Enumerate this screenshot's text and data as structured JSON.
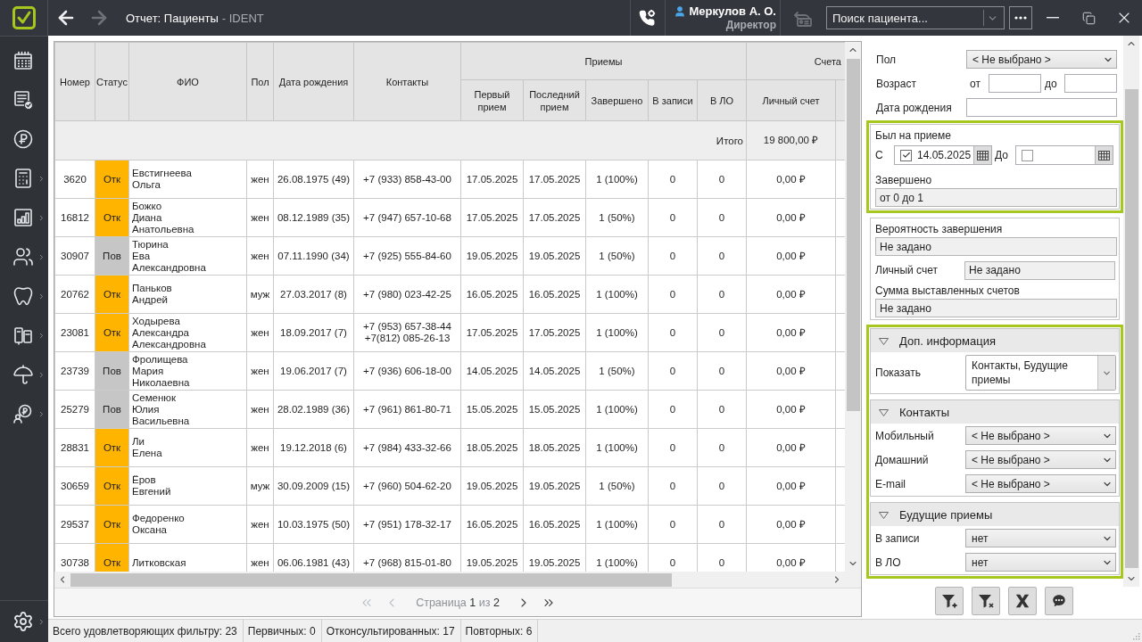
{
  "header": {
    "nav": [
      {
        "kind": "back",
        "disabled": false
      },
      {
        "kind": "forward",
        "disabled": true
      }
    ],
    "title": "Отчет: Пациенты",
    "suffix": "- IDENT",
    "user": {
      "name": "Меркулов А. О.",
      "role": "Директор"
    },
    "return_button": {
      "disabled": true
    },
    "search": {
      "placeholder": "Поиск пациента..."
    }
  },
  "sidebar": {
    "items": [
      {
        "kind": "schedule",
        "submenu": false
      },
      {
        "kind": "tasks",
        "submenu": false
      },
      {
        "kind": "payments",
        "submenu": false
      },
      {
        "kind": "cashbox",
        "submenu": true
      },
      {
        "kind": "reports",
        "submenu": true
      },
      {
        "kind": "patients",
        "submenu": true
      },
      {
        "kind": "dentistry",
        "submenu": true
      },
      {
        "kind": "equipment",
        "submenu": true
      },
      {
        "kind": "insurance",
        "submenu": true
      },
      {
        "kind": "loyalty",
        "submenu": true
      }
    ],
    "footer": {
      "kind": "settings",
      "submenu": true
    }
  },
  "table": {
    "columns": [
      {
        "label": "Номер"
      },
      {
        "label": "Статус"
      },
      {
        "label": "ФИО"
      },
      {
        "label": "Пол"
      },
      {
        "label": "Дата рождения"
      },
      {
        "label": "Контакты"
      },
      {
        "label": "Приемы",
        "children": [
          {
            "label": "Первый прием"
          },
          {
            "label": "Последний прием"
          },
          {
            "label": "Завершено"
          },
          {
            "label": "В записи"
          },
          {
            "label": "В ЛО"
          }
        ]
      },
      {
        "label": "Счета",
        "children": [
          {
            "label": "Личный счет"
          }
        ]
      }
    ],
    "totals": {
      "label": "Итого",
      "personal_account": "19 800,00 ₽"
    },
    "rows": [
      {
        "number": "3620",
        "status": {
          "label": "Отк",
          "color": "#ffb400"
        },
        "name": "Евстигнеева\nОльга",
        "sex": "жен",
        "birth_date": "26.08.1975 (49)",
        "contacts": "+7 (933) 858-43-00",
        "first_visit": "17.05.2025",
        "last_visit": "17.05.2025",
        "completed": "1 (100%)",
        "scheduled": "0",
        "in_lo": "0",
        "personal_account": "0,00 ₽"
      },
      {
        "number": "16812",
        "status": {
          "label": "Отк",
          "color": "#ffb400"
        },
        "name": "Божко\nДиана\nАнатольевна",
        "sex": "жен",
        "birth_date": "08.12.1989 (35)",
        "contacts": "+7 (947) 657-10-68",
        "first_visit": "17.05.2025",
        "last_visit": "17.05.2025",
        "completed": "1 (50%)",
        "scheduled": "0",
        "in_lo": "0",
        "personal_account": "0,00 ₽"
      },
      {
        "number": "30907",
        "status": {
          "label": "Пов",
          "color": "#c6c6c6"
        },
        "name": "Тюрина\nЕва\nАлександровна",
        "sex": "жен",
        "birth_date": "07.11.1990 (34)",
        "contacts": "+7 (925) 555-84-60",
        "first_visit": "19.05.2025",
        "last_visit": "19.05.2025",
        "completed": "1 (50%)",
        "scheduled": "0",
        "in_lo": "0",
        "personal_account": "0,00 ₽"
      },
      {
        "number": "20762",
        "status": {
          "label": "Отк",
          "color": "#ffb400"
        },
        "name": "Паньков\nАндрей",
        "sex": "муж",
        "birth_date": "27.03.2017 (8)",
        "contacts": "+7 (980) 023-42-25",
        "first_visit": "16.05.2025",
        "last_visit": "16.05.2025",
        "completed": "1 (100%)",
        "scheduled": "0",
        "in_lo": "0",
        "personal_account": "0,00 ₽"
      },
      {
        "number": "23081",
        "status": {
          "label": "Отк",
          "color": "#ffb400"
        },
        "name": "Ходырева\nАлександра\nАлександровна",
        "sex": "жен",
        "birth_date": "18.09.2017 (7)",
        "contacts": "+7 (953) 657-38-44\n+7(812) 085-26-13",
        "first_visit": "17.05.2025",
        "last_visit": "17.05.2025",
        "completed": "1 (100%)",
        "scheduled": "0",
        "in_lo": "0",
        "personal_account": "0,00 ₽"
      },
      {
        "number": "23739",
        "status": {
          "label": "Пов",
          "color": "#c6c6c6"
        },
        "name": "Фролищева\nМария\nНиколаевна",
        "sex": "жен",
        "birth_date": "19.06.2017 (7)",
        "contacts": "+7 (936) 606-18-00",
        "first_visit": "14.05.2025",
        "last_visit": "14.05.2025",
        "completed": "1 (50%)",
        "scheduled": "0",
        "in_lo": "0",
        "personal_account": "0,00 ₽"
      },
      {
        "number": "25279",
        "status": {
          "label": "Пов",
          "color": "#c6c6c6"
        },
        "name": "Семенюк\nЮлия\nВасильевна",
        "sex": "жен",
        "birth_date": "28.02.1989 (36)",
        "contacts": "+7 (961) 861-80-71",
        "first_visit": "15.05.2025",
        "last_visit": "15.05.2025",
        "completed": "1 (100%)",
        "scheduled": "0",
        "in_lo": "0",
        "personal_account": "0,00 ₽"
      },
      {
        "number": "28831",
        "status": {
          "label": "Отк",
          "color": "#ffb400"
        },
        "name": "Ли\nЕлена",
        "sex": "жен",
        "birth_date": "19.12.2018 (6)",
        "contacts": "+7 (984) 433-32-66",
        "first_visit": "18.05.2025",
        "last_visit": "18.05.2025",
        "completed": "1 (100%)",
        "scheduled": "0",
        "in_lo": "0",
        "personal_account": "0,00 ₽"
      },
      {
        "number": "30659",
        "status": {
          "label": "Отк",
          "color": "#ffb400"
        },
        "name": "Ёров\nЕвгений",
        "sex": "муж",
        "birth_date": "30.09.2009 (15)",
        "contacts": "+7 (960) 504-62-20",
        "first_visit": "19.05.2025",
        "last_visit": "19.05.2025",
        "completed": "1 (50%)",
        "scheduled": "0",
        "in_lo": "0",
        "personal_account": "0,00 ₽"
      },
      {
        "number": "29537",
        "status": {
          "label": "Отк",
          "color": "#ffb400"
        },
        "name": "Федоренко\nОксана",
        "sex": "жен",
        "birth_date": "10.03.1975 (50)",
        "contacts": "+7 (951) 178-32-17",
        "first_visit": "16.05.2025",
        "last_visit": "16.05.2025",
        "completed": "1 (100%)",
        "scheduled": "0",
        "in_lo": "0",
        "personal_account": "0,00 ₽"
      },
      {
        "number": "30738",
        "status": {
          "label": "Отк",
          "color": "#ffb400"
        },
        "name": "Литковская",
        "sex": "жен",
        "birth_date": "06.06.1981 (43)",
        "contacts": "+7 (968) 815-01-80",
        "first_visit": "19.05.2025",
        "last_visit": "19.05.2025",
        "completed": "1 (100%)",
        "scheduled": "0",
        "in_lo": "0",
        "personal_account": "0,00 ₽"
      }
    ]
  },
  "pagination": {
    "first": {
      "disabled": true
    },
    "prev": {
      "disabled": true
    },
    "label": "Страница",
    "page": "1",
    "of": "из",
    "pages": "2",
    "next": {
      "disabled": false
    },
    "last": {
      "disabled": false
    }
  },
  "filters": {
    "fields": [
      {
        "kind": "select",
        "label": "Пол",
        "value": "< Не выбрано >"
      },
      {
        "kind": "range",
        "label": "Возраст",
        "from_label": "от",
        "to_label": "до"
      },
      {
        "kind": "text",
        "label": "Дата рождения"
      }
    ],
    "groups": [
      {
        "highlighted": true,
        "items": [
          {
            "kind": "date_range",
            "label": "Был на приеме",
            "from_label": "С",
            "from": {
              "checked": true,
              "value": "14.05.2025"
            },
            "to_label": "До",
            "to": {
              "checked": false
            }
          },
          {
            "kind": "stacked",
            "label": "Завершено",
            "value": "от 0 до 1"
          }
        ]
      },
      {
        "highlighted": false,
        "items": [
          {
            "kind": "stacked",
            "label": "Вероятность завершения",
            "value": "Не задано"
          },
          {
            "kind": "inline",
            "label": "Личный счет",
            "value": "Не задано"
          },
          {
            "kind": "stacked",
            "label": "Сумма выставленных счетов",
            "value": "Не задано"
          }
        ]
      }
    ],
    "extra": {
      "highlighted": true,
      "sections": [
        {
          "title": "Доп. информация",
          "expanded": true,
          "fields": [
            {
              "kind": "multiselect",
              "label": "Показать",
              "value": "Контакты, Будущие приемы"
            }
          ]
        },
        {
          "title": "Контакты",
          "expanded": true,
          "fields": [
            {
              "kind": "select",
              "label": "Мобильный",
              "value": "< Не выбрано >"
            },
            {
              "kind": "select",
              "label": "Домашний",
              "value": "< Не выбрано >"
            },
            {
              "kind": "select",
              "label": "E-mail",
              "value": "< Не выбрано >"
            }
          ]
        },
        {
          "title": "Будущие приемы",
          "expanded": true,
          "fields": [
            {
              "kind": "select",
              "label": "В записи",
              "value": "нет"
            },
            {
              "kind": "select",
              "label": "В ЛО",
              "value": "нет"
            }
          ]
        }
      ]
    }
  },
  "status_bar": [
    "Всего удовлетворяющих фильтру: 23",
    "Первичных: 0",
    "Отконсультированных: 17",
    "Повторных: 6"
  ]
}
